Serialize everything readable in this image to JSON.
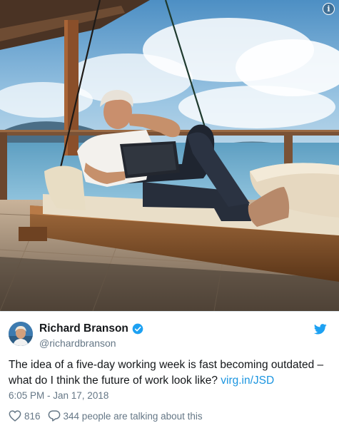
{
  "photo": {
    "alt": "",
    "info_icon_glyph": "i"
  },
  "author": {
    "display_name": "Richard Branson",
    "handle": "@richardbranson",
    "verified": true
  },
  "tweet": {
    "text_before_link": "The idea of a five-day working week is fast becoming outdated – what do I think the future of work look like? ",
    "link_text": "virg.in/JSD",
    "timestamp": "6:05 PM - Jan 17, 2018"
  },
  "actions": {
    "like_count": "816",
    "reply_text": "344 people are talking about this"
  },
  "colors": {
    "link": "#1b95e0",
    "secondary_text": "#657786",
    "twitter_blue": "#1da1f2"
  },
  "icons": [
    "info-icon",
    "verified-icon",
    "twitter-bird-icon",
    "heart-icon",
    "reply-bubble-icon"
  ]
}
